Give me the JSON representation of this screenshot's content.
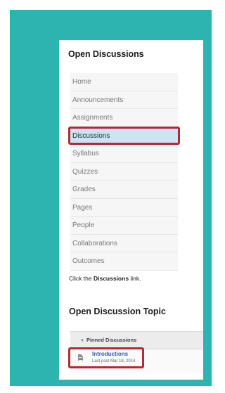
{
  "heading": "Open Discussions",
  "nav": {
    "items": [
      {
        "label": "Home",
        "active": false
      },
      {
        "label": "Announcements",
        "active": false
      },
      {
        "label": "Assignments",
        "active": false
      },
      {
        "label": "Discussions",
        "active": true
      },
      {
        "label": "Syllabus",
        "active": false
      },
      {
        "label": "Quizzes",
        "active": false
      },
      {
        "label": "Grades",
        "active": false
      },
      {
        "label": "Pages",
        "active": false
      },
      {
        "label": "People",
        "active": false
      },
      {
        "label": "Collaborations",
        "active": false
      },
      {
        "label": "Outcomes",
        "active": false
      }
    ]
  },
  "instruction": {
    "prefix": "Click the ",
    "emphasis": "Discussions",
    "suffix": " link."
  },
  "section_heading": "Open Discussion Topic",
  "pinned": {
    "caret_icon": "triangle-down",
    "label": "Pinned Discussions",
    "topic": {
      "icon": "document-icon",
      "title": "Introductions",
      "meta": "Last post Mar 18, 2014"
    }
  },
  "colors": {
    "border": "#2db3b0",
    "highlight": "#b32a30",
    "active_bg": "#cfe2f2",
    "link": "#2a5bb8"
  }
}
